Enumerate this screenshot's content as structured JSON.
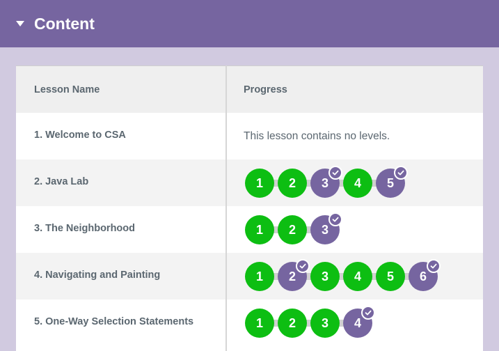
{
  "section": {
    "title": "Content"
  },
  "table": {
    "headers": {
      "lesson_name": "Lesson Name",
      "progress": "Progress"
    },
    "rows": [
      {
        "lesson": "1. Welcome to CSA",
        "no_levels_text": "This lesson contains no levels.",
        "levels": []
      },
      {
        "lesson": "2. Java Lab",
        "levels": [
          {
            "label": "1",
            "status": "completed"
          },
          {
            "label": "2",
            "status": "completed"
          },
          {
            "label": "3",
            "status": "submitted"
          },
          {
            "label": "4",
            "status": "completed"
          },
          {
            "label": "5",
            "status": "submitted"
          }
        ]
      },
      {
        "lesson": "3. The Neighborhood",
        "levels": [
          {
            "label": "1",
            "status": "completed"
          },
          {
            "label": "2",
            "status": "completed"
          },
          {
            "label": "3",
            "status": "submitted"
          }
        ]
      },
      {
        "lesson": "4. Navigating and Painting",
        "levels": [
          {
            "label": "1",
            "status": "completed"
          },
          {
            "label": "2",
            "status": "submitted"
          },
          {
            "label": "3",
            "status": "completed"
          },
          {
            "label": "4",
            "status": "completed"
          },
          {
            "label": "5",
            "status": "completed"
          },
          {
            "label": "6",
            "status": "submitted"
          }
        ]
      },
      {
        "lesson": "5. One-Way Selection Statements",
        "levels": [
          {
            "label": "1",
            "status": "completed"
          },
          {
            "label": "2",
            "status": "completed"
          },
          {
            "label": "3",
            "status": "completed"
          },
          {
            "label": "4",
            "status": "submitted"
          }
        ]
      }
    ]
  },
  "colors": {
    "header_bg": "#7665a0",
    "page_bg": "#d1cae0",
    "completed": "#0dbe12",
    "submitted": "#7665a0",
    "text": "#5b6770"
  },
  "icons": {
    "collapse": "caret-down-icon",
    "submitted_badge": "checkmark-icon"
  }
}
